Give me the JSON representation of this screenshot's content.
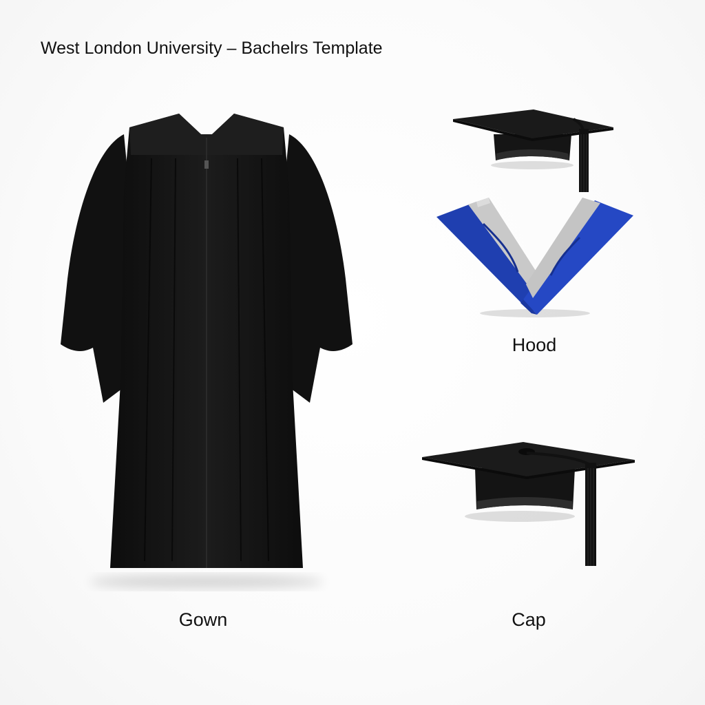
{
  "title": "West London University – Bachelrs Template",
  "items": {
    "gown": {
      "label": "Gown",
      "icon": "graduation-gown-icon"
    },
    "hood": {
      "label": "Hood",
      "icon": "graduation-hood-icon"
    },
    "cap": {
      "label": "Cap",
      "icon": "mortarboard-cap-icon"
    },
    "hood_cap": {
      "icon": "mortarboard-cap-icon"
    }
  },
  "colors": {
    "gown": "#141414",
    "hood_blue": "#1f3fb0",
    "hood_grey": "#c9c9c9",
    "cap": "#1a1a1a",
    "background": "#fafafa"
  }
}
